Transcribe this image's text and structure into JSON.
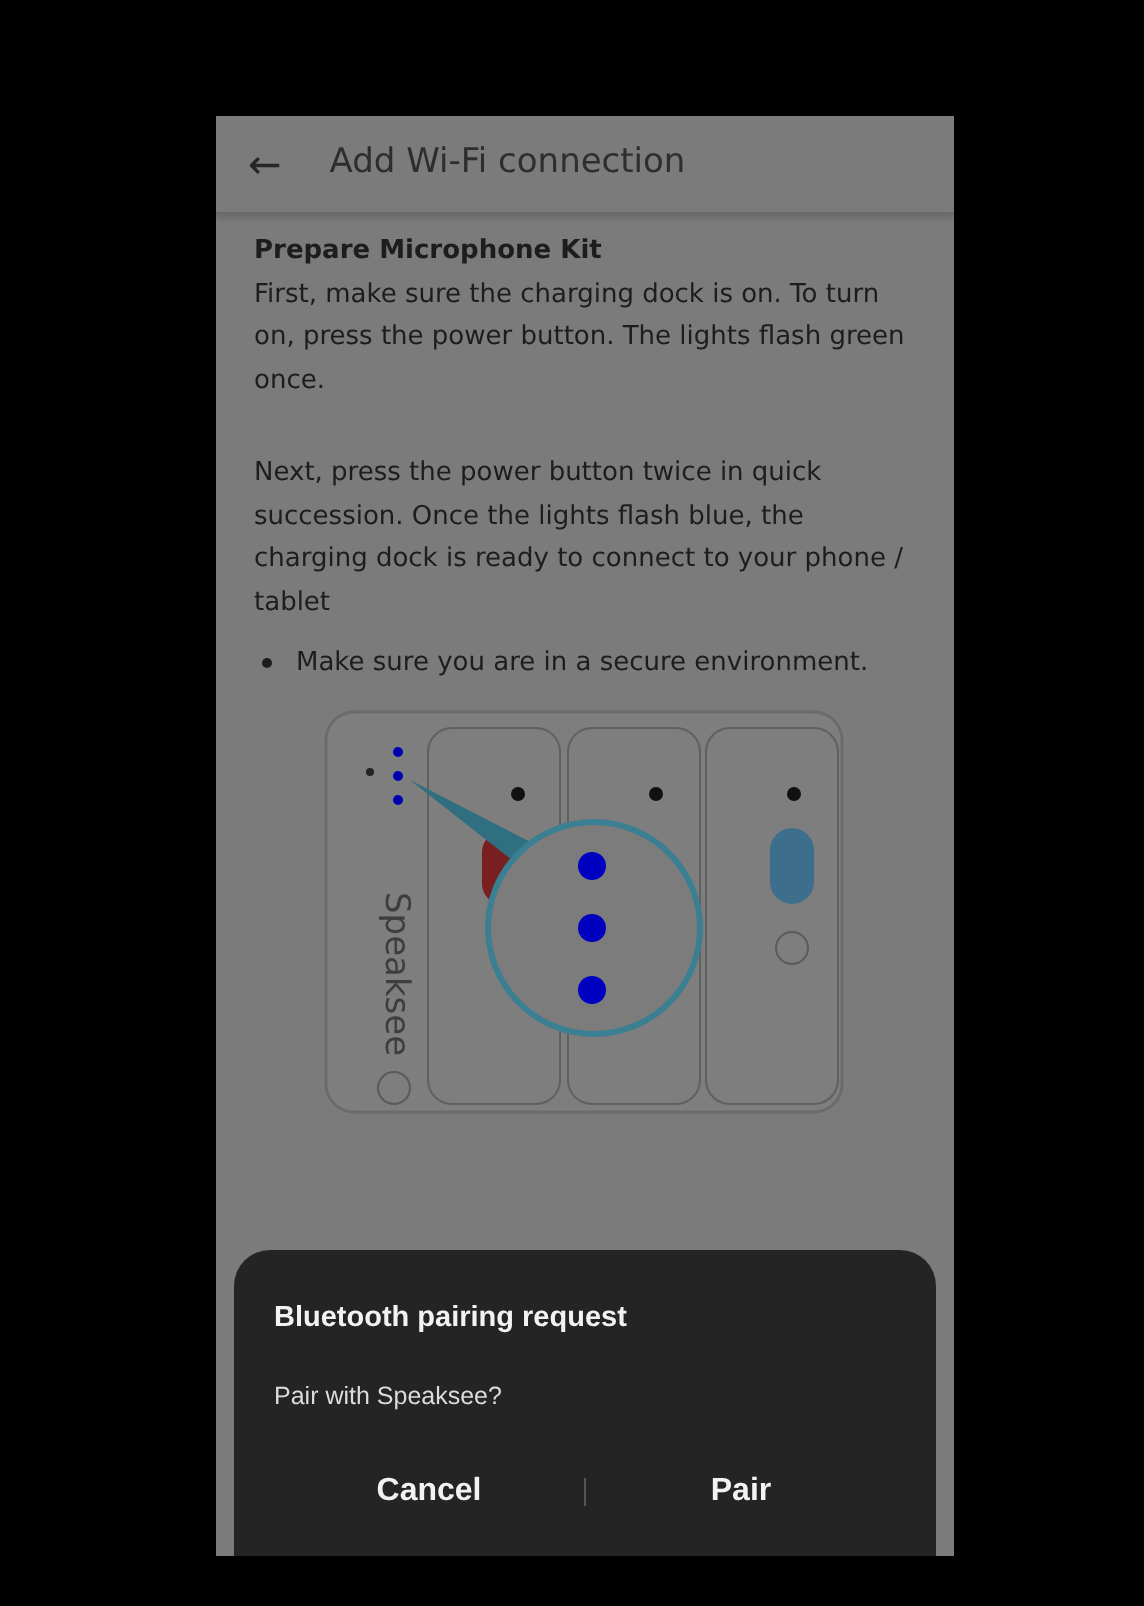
{
  "app_bar": {
    "back_icon": "←",
    "title": "Add Wi-Fi connection"
  },
  "content": {
    "heading": "Prepare Microphone Kit",
    "paragraphs": [
      "First, make sure the charging dock is on. To turn on, press the power button. The lights flash green once.",
      "Next, press the power button twice in quick succession. Once the lights flash blue, the charging dock is ready to connect to your phone / tablet"
    ],
    "bullets": [
      "Make sure you are in a secure environment."
    ],
    "illustration": {
      "logo_text": "Speaksee"
    }
  },
  "dialog": {
    "title": "Bluetooth pairing request",
    "message": "Pair with Speaksee?",
    "buttons": [
      "Cancel",
      "Pair"
    ]
  }
}
